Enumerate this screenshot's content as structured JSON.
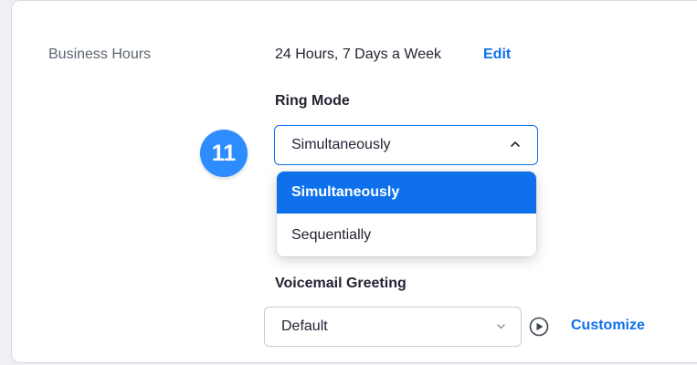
{
  "business_hours": {
    "label": "Business Hours",
    "value": "24 Hours, 7 Days a Week",
    "edit_label": "Edit"
  },
  "ring_mode": {
    "label": "Ring Mode",
    "selected": "Simultaneously",
    "options": [
      "Simultaneously",
      "Sequentially"
    ],
    "step_badge": "11",
    "expanded_icon": "chevron-up-icon"
  },
  "voicemail": {
    "label": "Voicemail Greeting",
    "selected": "Default",
    "play_icon": "play-circle-icon",
    "customize_label": "Customize"
  },
  "colors": {
    "accent": "#0e71eb",
    "badge": "#2d8cff",
    "text": "#232333",
    "muted_label": "#5b6573"
  }
}
